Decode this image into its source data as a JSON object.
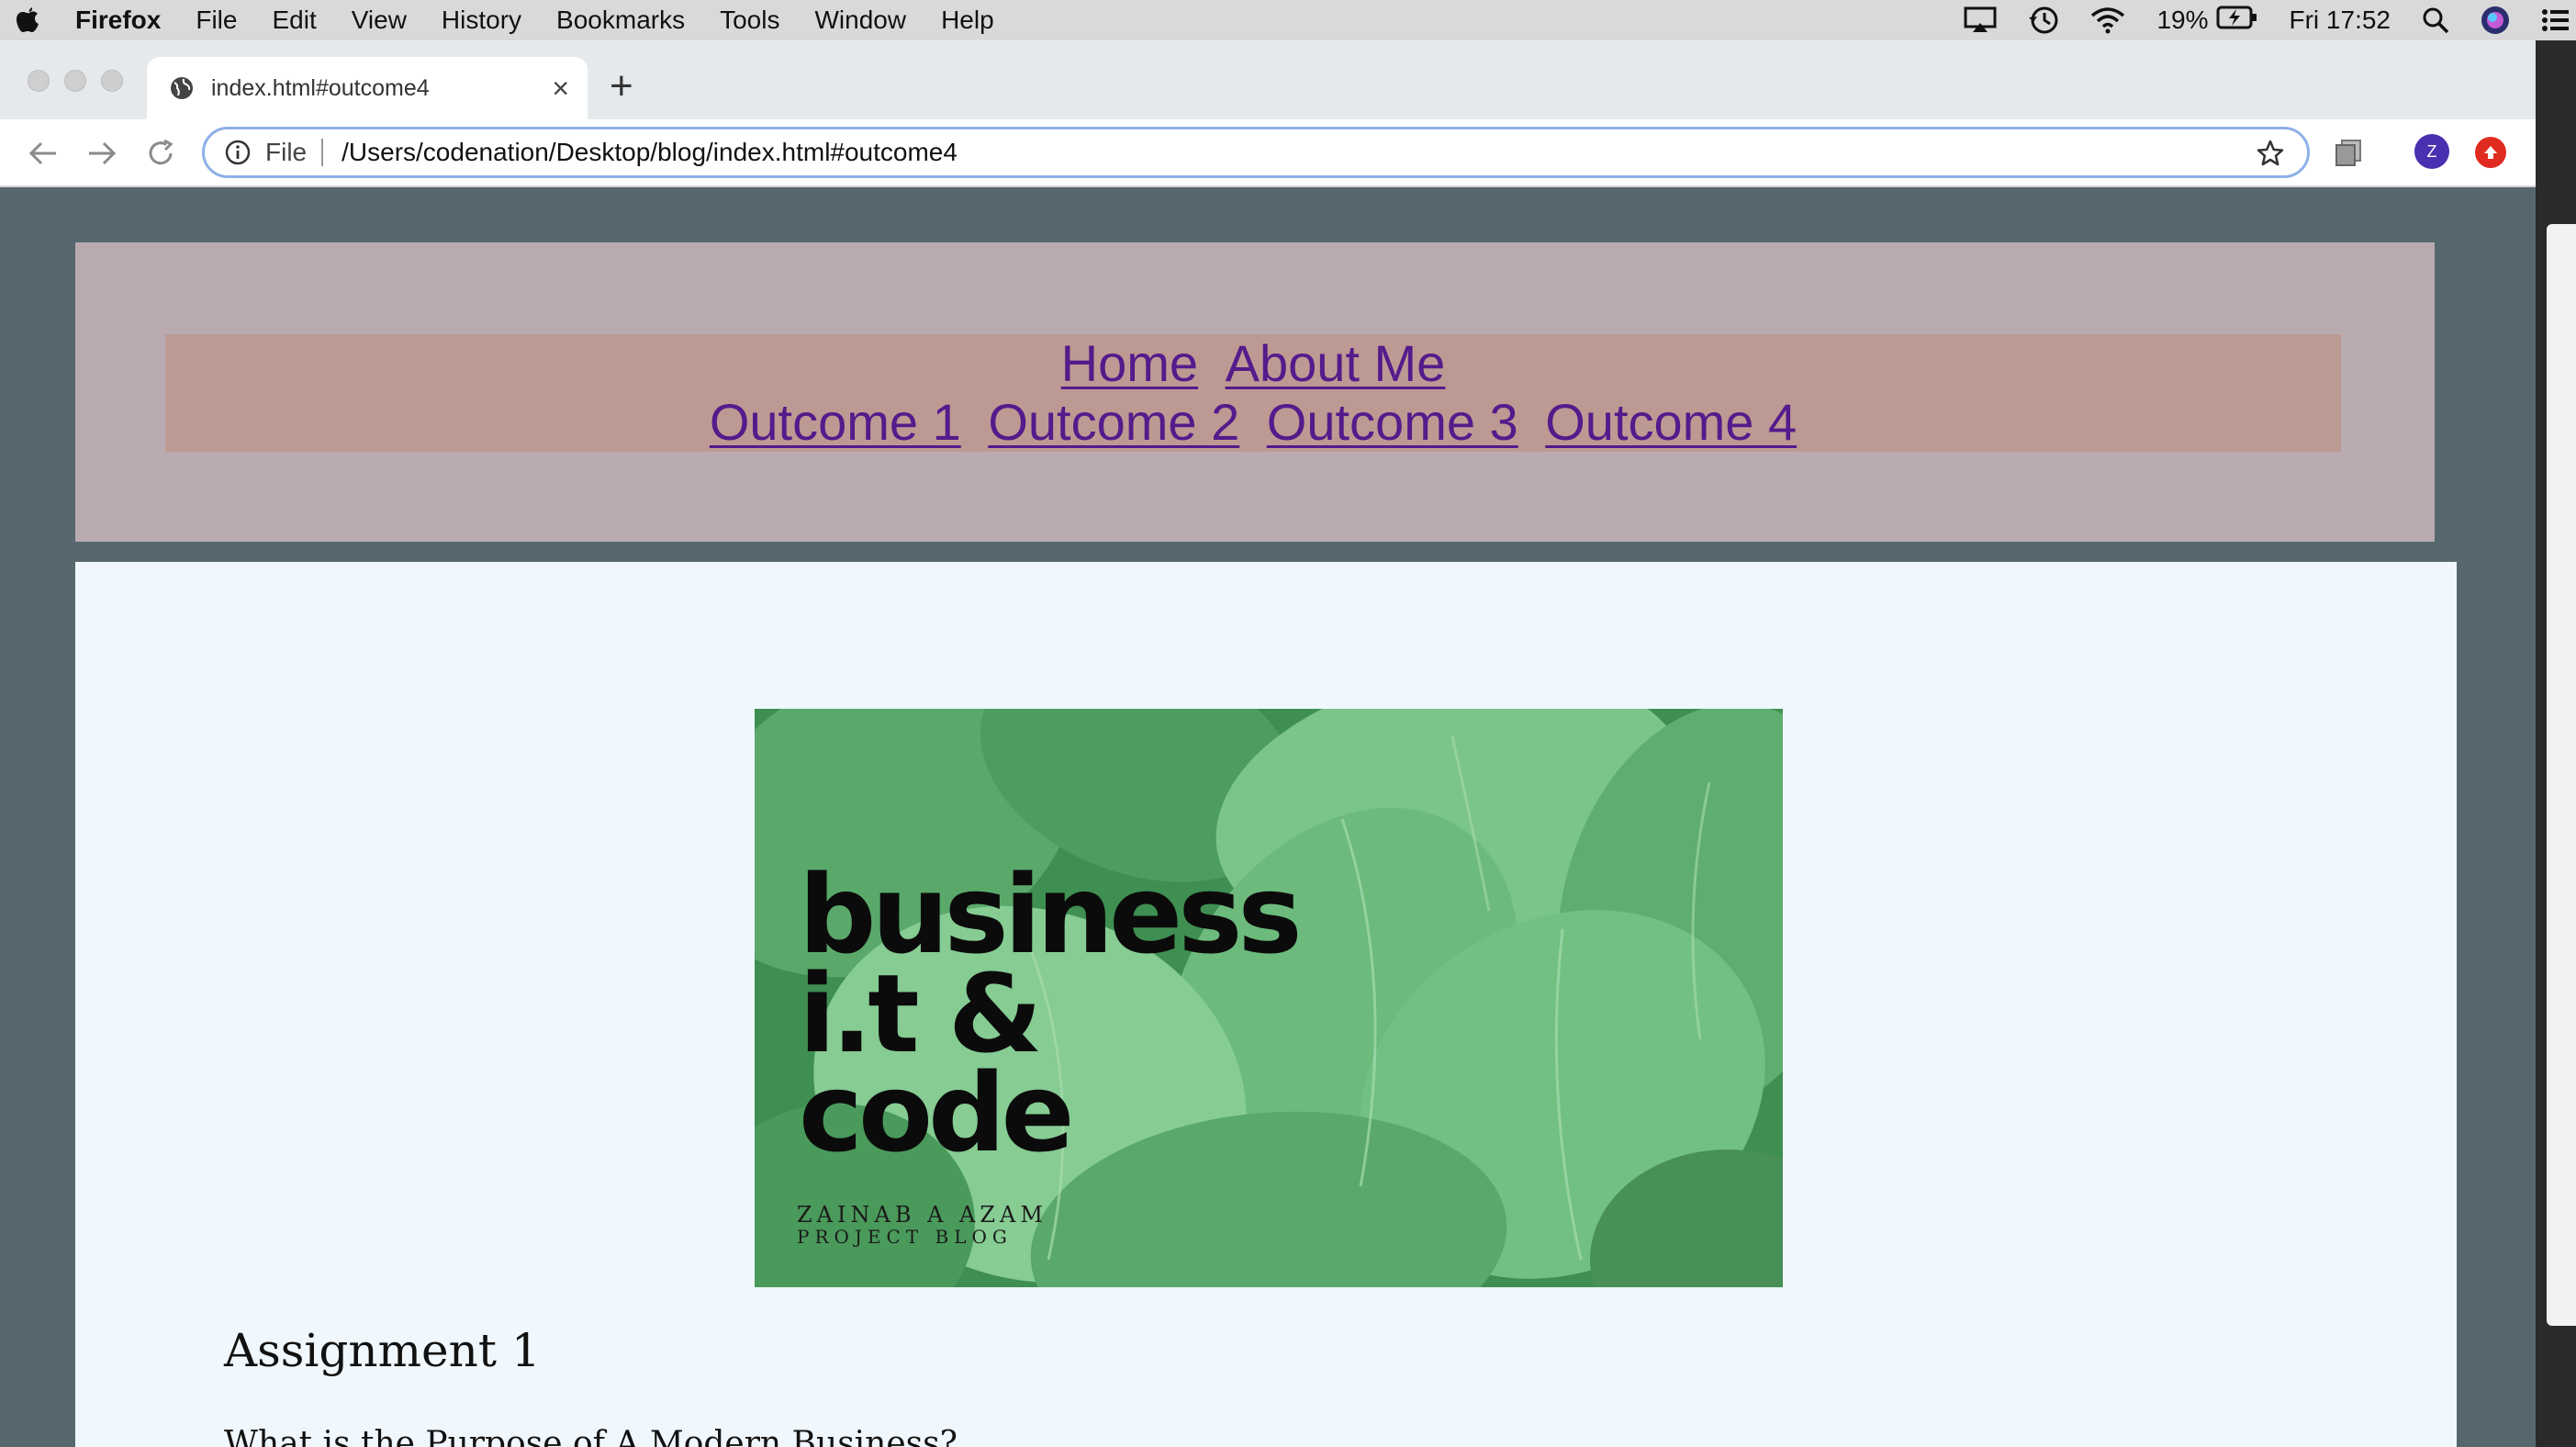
{
  "menubar": {
    "app_name": "Firefox",
    "items": [
      "File",
      "Edit",
      "View",
      "History",
      "Bookmarks",
      "Tools",
      "Window",
      "Help"
    ],
    "battery_percent": "19%",
    "clock": "Fri 17:52"
  },
  "browser": {
    "tab_title": "index.html#outcome4",
    "url_scheme_label": "File",
    "url": "/Users/codenation/Desktop/blog/index.html#outcome4",
    "profile_initial": "Z"
  },
  "nav": {
    "row1": [
      "Home",
      "About Me"
    ],
    "row2": [
      "Outcome 1",
      "Outcome 2",
      "Outcome 3",
      "Outcome 4"
    ]
  },
  "hero": {
    "lines": [
      "business",
      "i.t &",
      "code"
    ],
    "author": "ZAINAB A AZAM",
    "tagline": "PROJECT BLOG"
  },
  "content": {
    "assignment_title": "Assignment 1",
    "question": "What is the Purpose of A Modern Business?"
  },
  "colors": {
    "page_bg": "#56686e",
    "header_bg": "#b9aab0",
    "nav_bg": "#bc9a93",
    "link": "#551a8b",
    "card_bg": "#f0f7fd"
  }
}
